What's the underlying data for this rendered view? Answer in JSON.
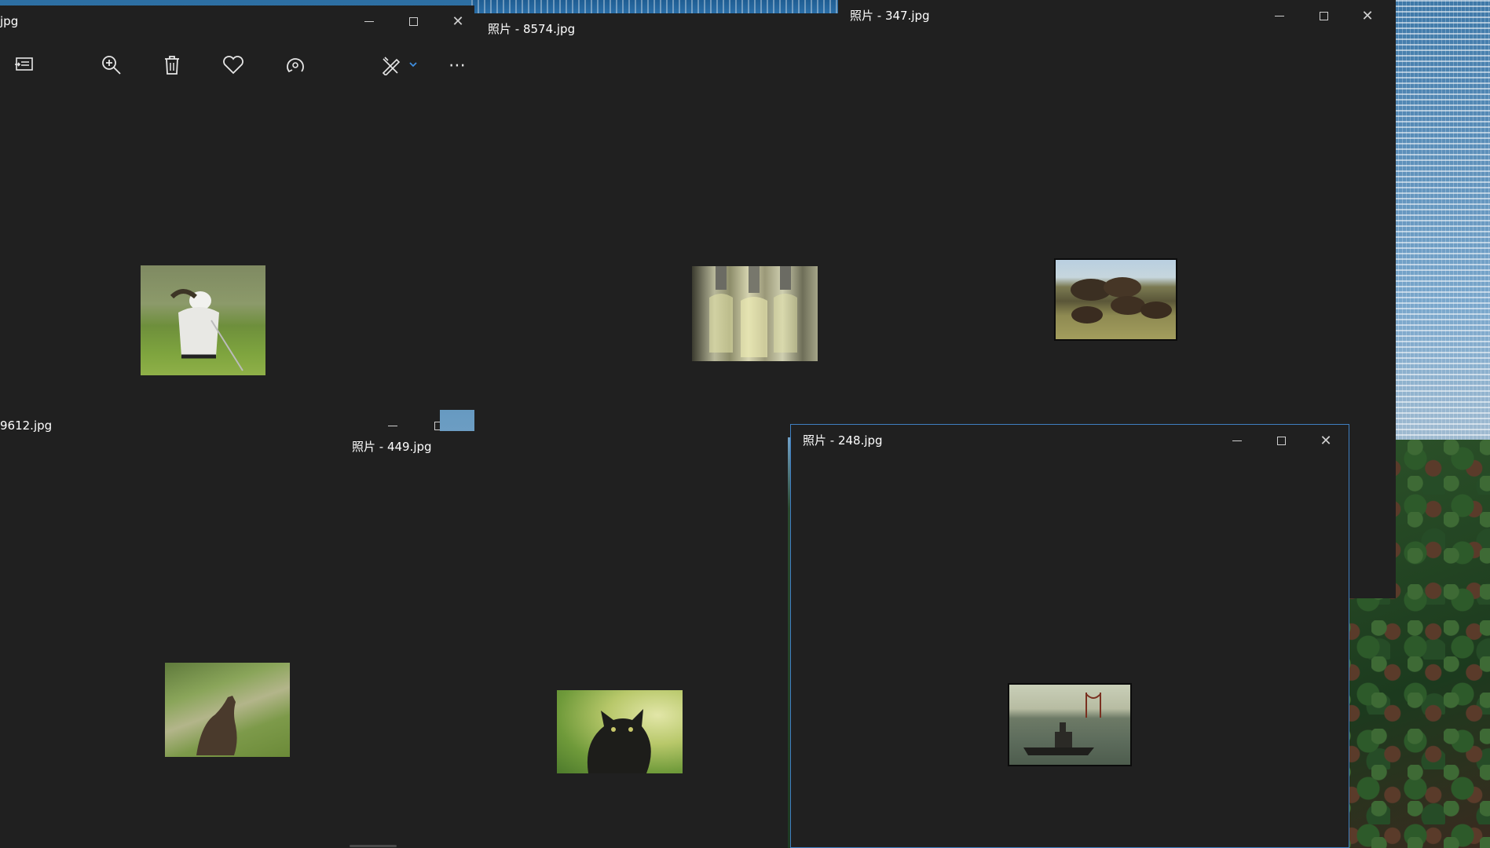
{
  "windows": {
    "golfer": {
      "title": "jpg"
    },
    "glass": {
      "title": "照片 - 8574.jpg"
    },
    "bison": {
      "title": "照片 - 347.jpg"
    },
    "lynx": {
      "title": "9612.jpg"
    },
    "cat": {
      "title": "照片 - 449.jpg"
    },
    "ship": {
      "title": "照片 - 248.jpg"
    }
  },
  "icons": {
    "slideshow": "slideshow-icon",
    "zoom": "zoom-in-icon",
    "delete": "trash-icon",
    "favorite": "heart-icon",
    "rotate": "rotate-icon",
    "edit": "edit-create-icon",
    "more": "more-icon"
  },
  "colors": {
    "window_bg": "#202020",
    "active_border": "#3f7fc1",
    "accent": "#0078d7"
  }
}
